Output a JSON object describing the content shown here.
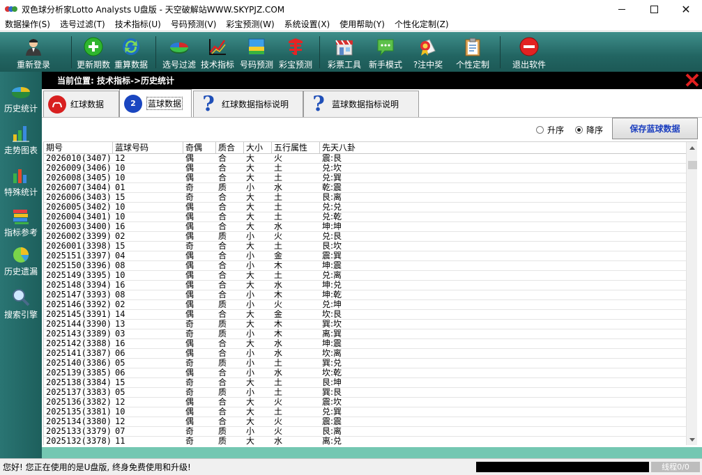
{
  "window": {
    "title": "双色球分析家Lotto Analysts U盘版 - 天空破解站WWW.SKYPJZ.COM",
    "minimize": "",
    "maximize": "",
    "close": "✕"
  },
  "menu": [
    "数据操作(S)",
    "选号过滤(T)",
    "技术指标(U)",
    "号码预测(V)",
    "彩宝预测(W)",
    "系统设置(X)",
    "使用帮助(Y)",
    "个性化定制(Z)"
  ],
  "toolbar": {
    "relogin": "重新登录",
    "update": "更新期数",
    "recalc": "重算数据",
    "filter": "选号过滤",
    "tech": "技术指标",
    "predict": "号码预测",
    "caibao": "彩宝预测",
    "tools": "彩票工具",
    "newbie": "新手模式",
    "prize": "?注中奖",
    "custom": "个性定制",
    "exit": "退出软件"
  },
  "nav": {
    "history": "历史统计",
    "trend": "走势图表",
    "special": "特殊统计",
    "indicator": "指标参考",
    "missing": "历史遗漏",
    "search": "搜索引擎"
  },
  "location": "当前位置: 技术指标->历史统计",
  "tabs": {
    "red": {
      "ball": "",
      "label": "红球数据"
    },
    "blue": {
      "ball": "2",
      "label": "蓝球数据"
    },
    "red_help": {
      "label": "红球数据指标说明"
    },
    "blue_help": {
      "label": "蓝球数据指标说明"
    }
  },
  "sort": {
    "asc": "升序",
    "desc": "降序",
    "save": "保存蓝球数据"
  },
  "table": {
    "headers": [
      "期号",
      "蓝球号码",
      "奇偶",
      "质合",
      "大小",
      "五行属性",
      "先天八卦"
    ],
    "rows": [
      [
        "2026010(3407)",
        "12",
        "偶",
        "合",
        "大",
        "火",
        "震:艮"
      ],
      [
        "2026009(3406)",
        "10",
        "偶",
        "合",
        "大",
        "土",
        "兑:坎"
      ],
      [
        "2026008(3405)",
        "10",
        "偶",
        "合",
        "大",
        "土",
        "兑:巽"
      ],
      [
        "2026007(3404)",
        "01",
        "奇",
        "质",
        "小",
        "水",
        "乾:震"
      ],
      [
        "2026006(3403)",
        "15",
        "奇",
        "合",
        "大",
        "土",
        "艮:离"
      ],
      [
        "2026005(3402)",
        "10",
        "偶",
        "合",
        "大",
        "土",
        "兑:兑"
      ],
      [
        "2026004(3401)",
        "10",
        "偶",
        "合",
        "大",
        "土",
        "兑:乾"
      ],
      [
        "2026003(3400)",
        "16",
        "偶",
        "合",
        "大",
        "水",
        "坤:坤"
      ],
      [
        "2026002(3399)",
        "02",
        "偶",
        "质",
        "小",
        "火",
        "兑:艮"
      ],
      [
        "2026001(3398)",
        "15",
        "奇",
        "合",
        "大",
        "土",
        "艮:坎"
      ],
      [
        "2025151(3397)",
        "04",
        "偶",
        "合",
        "小",
        "金",
        "震:巽"
      ],
      [
        "2025150(3396)",
        "08",
        "偶",
        "合",
        "小",
        "木",
        "坤:震"
      ],
      [
        "2025149(3395)",
        "10",
        "偶",
        "合",
        "大",
        "土",
        "兑:离"
      ],
      [
        "2025148(3394)",
        "16",
        "偶",
        "合",
        "大",
        "水",
        "坤:兑"
      ],
      [
        "2025147(3393)",
        "08",
        "偶",
        "合",
        "小",
        "木",
        "坤:乾"
      ],
      [
        "2025146(3392)",
        "02",
        "偶",
        "质",
        "小",
        "火",
        "兑:坤"
      ],
      [
        "2025145(3391)",
        "14",
        "偶",
        "合",
        "大",
        "金",
        "坎:艮"
      ],
      [
        "2025144(3390)",
        "13",
        "奇",
        "质",
        "大",
        "木",
        "巽:坎"
      ],
      [
        "2025143(3389)",
        "03",
        "奇",
        "质",
        "小",
        "木",
        "离:巽"
      ],
      [
        "2025142(3388)",
        "16",
        "偶",
        "合",
        "大",
        "水",
        "坤:震"
      ],
      [
        "2025141(3387)",
        "06",
        "偶",
        "合",
        "小",
        "水",
        "坎:离"
      ],
      [
        "2025140(3386)",
        "05",
        "奇",
        "质",
        "小",
        "土",
        "巽:兑"
      ],
      [
        "2025139(3385)",
        "06",
        "偶",
        "合",
        "小",
        "水",
        "坎:乾"
      ],
      [
        "2025138(3384)",
        "15",
        "奇",
        "合",
        "大",
        "土",
        "艮:坤"
      ],
      [
        "2025137(3383)",
        "05",
        "奇",
        "质",
        "小",
        "土",
        "巽:艮"
      ],
      [
        "2025136(3382)",
        "12",
        "偶",
        "合",
        "大",
        "火",
        "震:坎"
      ],
      [
        "2025135(3381)",
        "10",
        "偶",
        "合",
        "大",
        "土",
        "兑:巽"
      ],
      [
        "2025134(3380)",
        "12",
        "偶",
        "合",
        "大",
        "火",
        "震:震"
      ],
      [
        "2025133(3379)",
        "07",
        "奇",
        "质",
        "小",
        "火",
        "艮:离"
      ],
      [
        "2025132(3378)",
        "11",
        "奇",
        "质",
        "大",
        "水",
        "离:兑"
      ]
    ]
  },
  "status": {
    "message": "您好! 您正在使用的是U盘版, 终身免费使用和升级!",
    "threads": "线程0/0"
  },
  "colors": {
    "teal": "#226562",
    "strip": "#74c7b2",
    "save_text": "#1c3fbf",
    "close_x": "#e02020"
  }
}
